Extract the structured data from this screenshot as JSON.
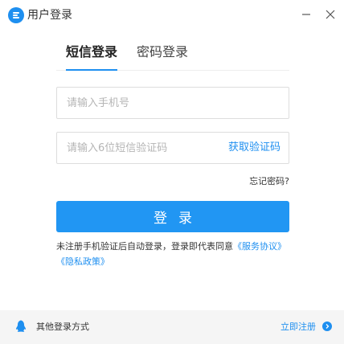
{
  "window": {
    "title": "用户登录",
    "logo_icon": "app-logo-icon",
    "minimize_icon": "minimize-icon",
    "close_icon": "close-icon"
  },
  "tabs": {
    "sms_label": "短信登录",
    "password_label": "密码登录",
    "active": "sms"
  },
  "form": {
    "phone_placeholder": "请输入手机号",
    "phone_value": "",
    "code_placeholder": "请输入6位短信验证码",
    "code_value": "",
    "get_code_label": "获取验证码",
    "forgot_password_label": "忘记密码?",
    "login_button_label": "登录"
  },
  "agreement": {
    "text": "未注册手机验证后自动登录，登录即代表同意",
    "service_link": "《服务协议》",
    "privacy_link": "《隐私政策》"
  },
  "footer": {
    "other_login_label": "其他登录方式",
    "register_label": "立即注册",
    "other_login_icon": "qq-penguin-icon",
    "register_icon": "chevron-right-icon"
  },
  "colors": {
    "accent": "#1e8ff0",
    "button": "#2196f3",
    "footer_bg": "#f5f5f5"
  }
}
